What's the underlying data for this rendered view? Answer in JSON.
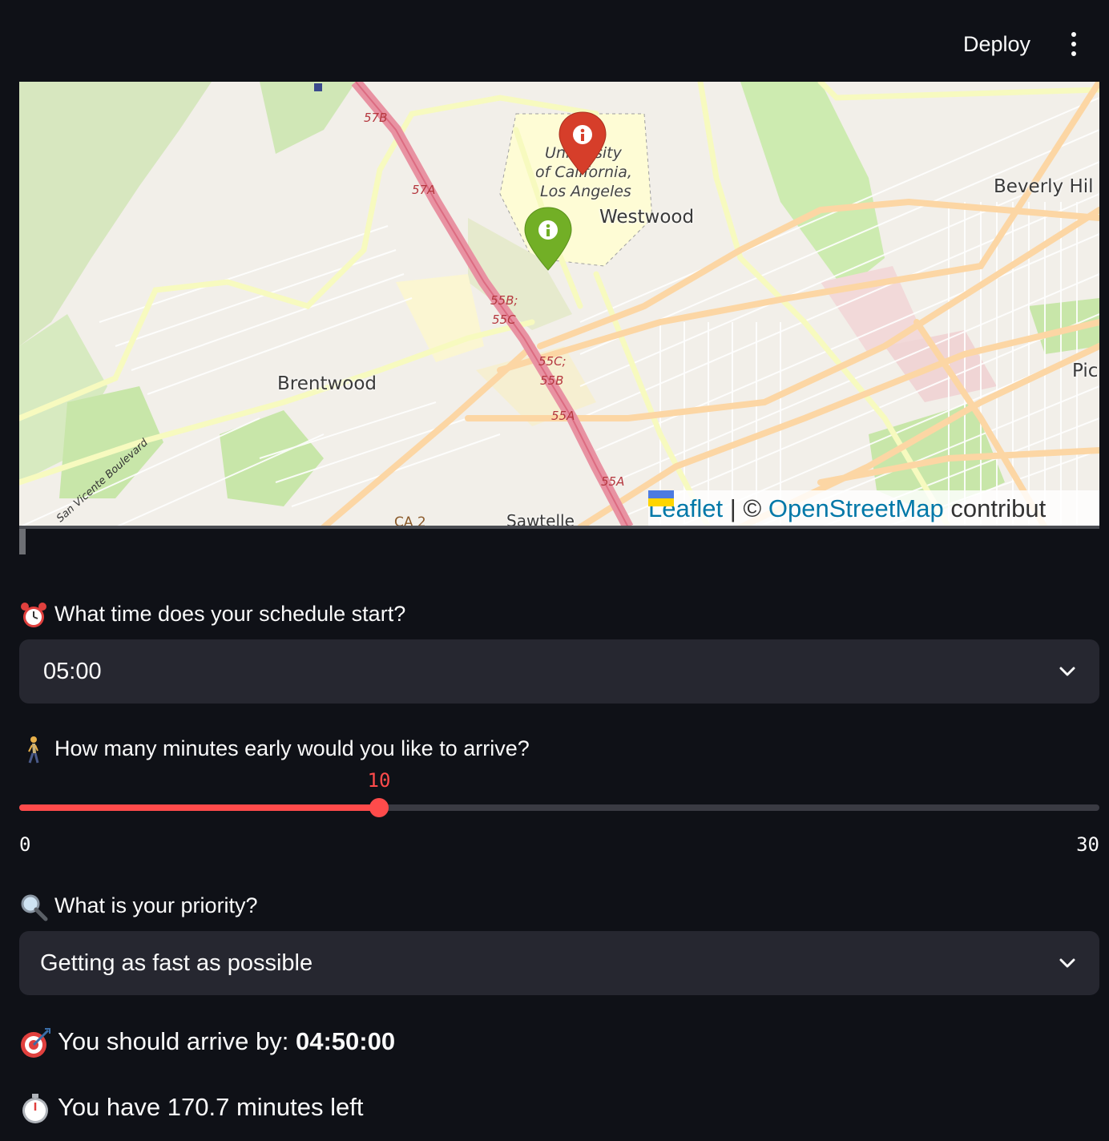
{
  "header": {
    "deploy_label": "Deploy",
    "menu_icon": "vertical-ellipsis-icon"
  },
  "map": {
    "place_labels": {
      "westwood": "Westwood",
      "brentwood": "Brentwood",
      "beverly_hills": "Beverly Hil",
      "sawtelle": "Sawtelle",
      "pico": "Pic",
      "campus_line1": "University",
      "campus_line2": "of California,",
      "campus_line3": "Los Angeles",
      "san_vicente": "San Vicente Boulevard",
      "ca2": "CA 2"
    },
    "exit_labels": {
      "e57b": "57B",
      "e57a": "57A",
      "e55b_55c": "55B;",
      "e55c": "55C",
      "e55c_55b_1": "55C;",
      "e55c_55b_2": "55B",
      "e55a_1": "55A",
      "e55a_2": "55A"
    },
    "markers": [
      {
        "color": "#d63e2a",
        "icon": "info-icon"
      },
      {
        "color": "#72af26",
        "icon": "info-icon"
      }
    ],
    "attribution": {
      "leaflet": "Leaflet",
      "separator": "|",
      "copyright": "©",
      "osm": "OpenStreetMap",
      "contributors": "contribut"
    }
  },
  "schedule": {
    "emoji": "alarm-clock-icon",
    "label": "What time does your schedule start?",
    "selected": "05:00"
  },
  "early": {
    "emoji": "person-walking-icon",
    "label": "How many minutes early would you like to arrive?",
    "value": "10",
    "min": "0",
    "max": "30",
    "fraction": 0.3333
  },
  "priority": {
    "emoji": "magnifying-glass-icon",
    "label": "What is your priority?",
    "selected": "Getting as fast as possible"
  },
  "results": {
    "arrive_emoji": "direct-hit-icon",
    "arrive_prefix": "You should arrive by: ",
    "arrive_time": "04:50:00",
    "left_emoji": "stopwatch-icon",
    "left_text": "You have 170.7 minutes left"
  },
  "colors": {
    "background": "#0f1117",
    "accent": "#ff4b4b",
    "select_bg": "#262730",
    "motorway": "#e892a2",
    "primary_road": "#fcd6a4",
    "secondary_road": "#f7fabf"
  }
}
